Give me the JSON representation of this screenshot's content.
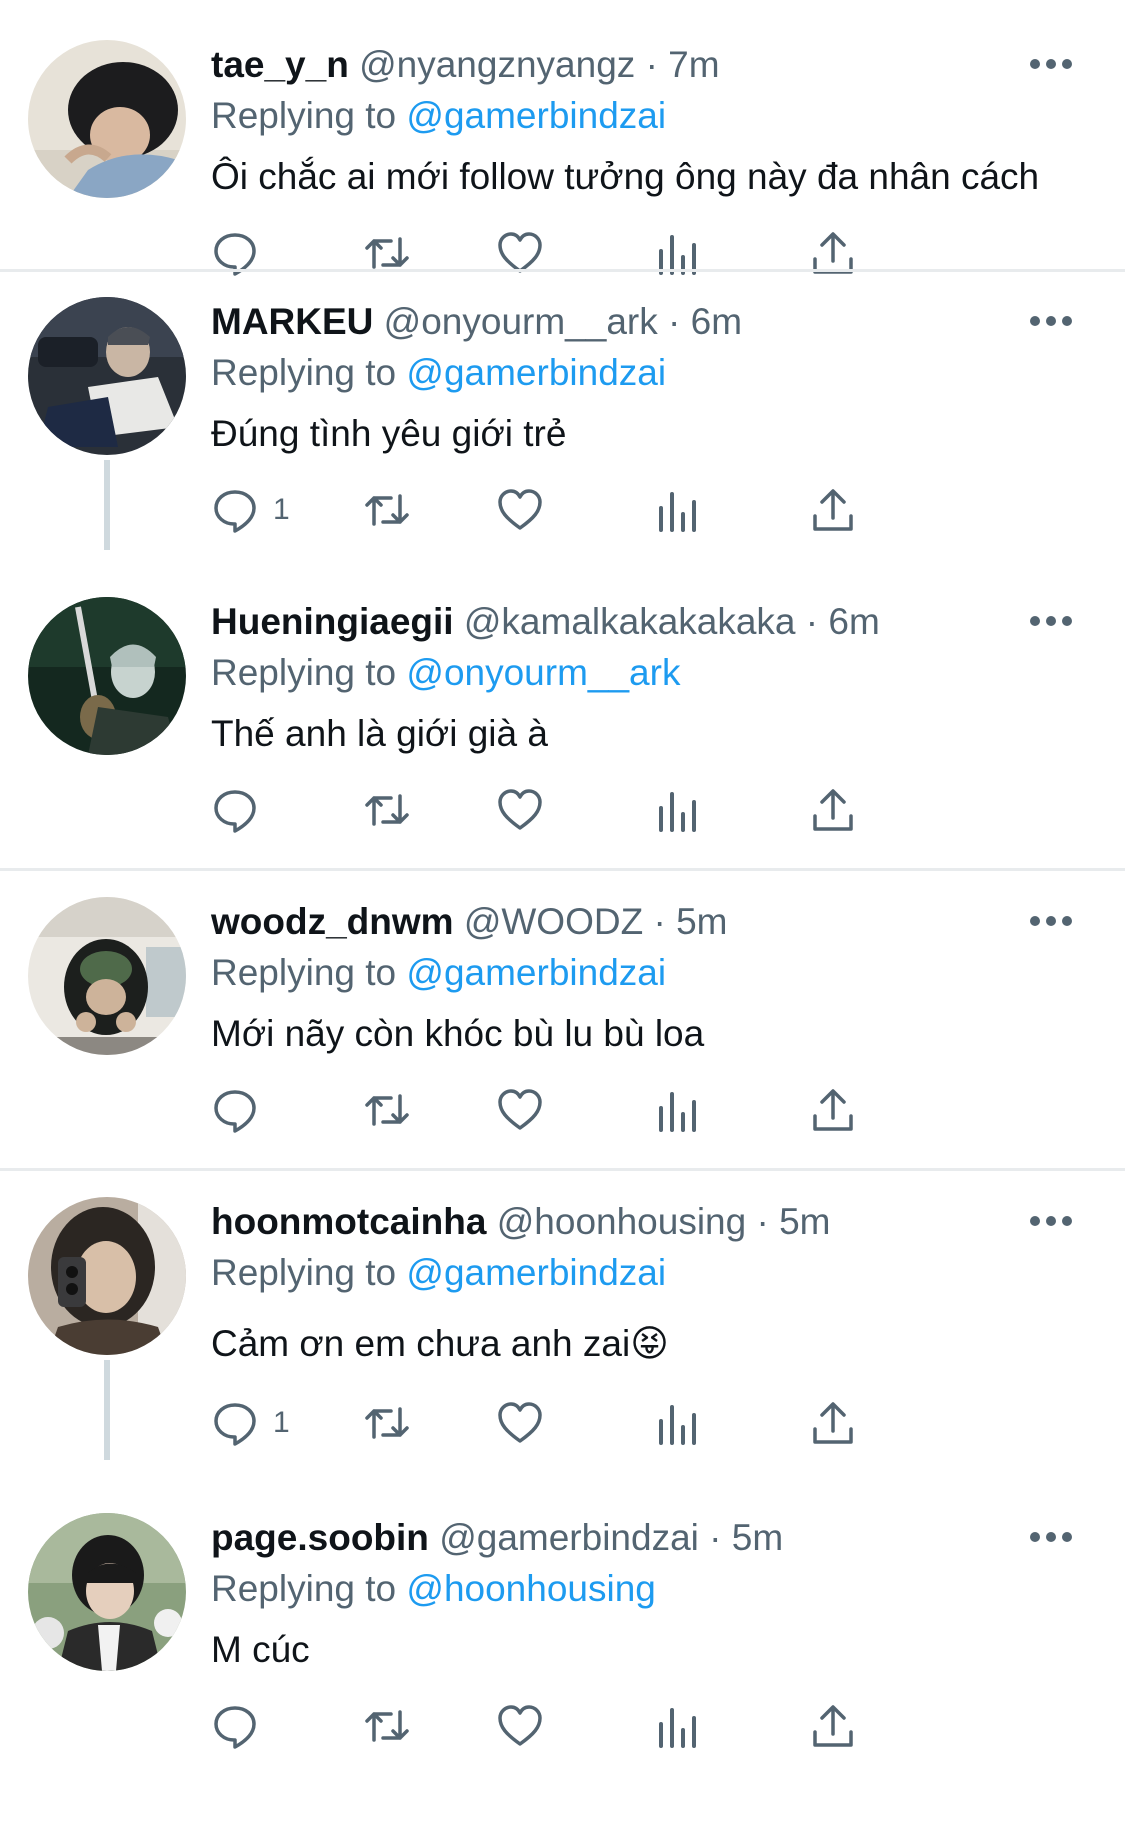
{
  "colors": {
    "name": "#0f1419",
    "secondary": "#536471",
    "mention": "#1d9bf0",
    "divider": "#e8ebed",
    "thread_line": "#cfd9de"
  },
  "tweets": [
    {
      "display_name": "tae_y_n",
      "handle": "@nyangznyangz",
      "separator": "·",
      "time": "7m",
      "replying_prefix": "Replying to",
      "replying_to": "@gamerbindzai",
      "text": "Ôi chắc ai mới follow tưởng ông này đa nhân cách",
      "reply_count": "",
      "avatar_icon": "avatar-photo"
    },
    {
      "display_name": "MARKEU",
      "handle": "@onyourm__ark",
      "separator": "·",
      "time": "6m",
      "replying_prefix": "Replying to",
      "replying_to": "@gamerbindzai",
      "text": "Đúng tình yêu giới trẻ",
      "reply_count": "1",
      "avatar_icon": "avatar-photo"
    },
    {
      "display_name": "Hueningiaegii",
      "handle": "@kamalkakakakaka",
      "separator": "·",
      "time": "6m",
      "replying_prefix": "Replying to",
      "replying_to": "@onyourm__ark",
      "text": "Thế anh là giới già à",
      "reply_count": "",
      "avatar_icon": "avatar-photo"
    },
    {
      "display_name": "woodz_dnwm",
      "handle": "@WOODZ",
      "separator": "·",
      "time": "5m",
      "replying_prefix": "Replying to",
      "replying_to": "@gamerbindzai",
      "text": "Mới nãy còn khóc bù lu bù loa",
      "reply_count": "",
      "avatar_icon": "avatar-photo"
    },
    {
      "display_name": "hoonmotcainha",
      "handle": "@hoonhousing",
      "separator": "·",
      "time": "5m",
      "replying_prefix": "Replying to",
      "replying_to": "@gamerbindzai",
      "text": "Cảm ơn em chưa anh zai😝",
      "reply_count": "1",
      "avatar_icon": "avatar-photo"
    },
    {
      "display_name": "page.soobin",
      "handle": "@gamerbindzai",
      "separator": "·",
      "time": "5m",
      "replying_prefix": "Replying to",
      "replying_to": "@hoonhousing",
      "text": "M cúc",
      "reply_count": "",
      "avatar_icon": "avatar-photo"
    }
  ],
  "action_icons": [
    "reply-icon",
    "retweet-icon",
    "like-icon",
    "views-icon",
    "share-icon"
  ],
  "more_icon": "more-options-icon"
}
